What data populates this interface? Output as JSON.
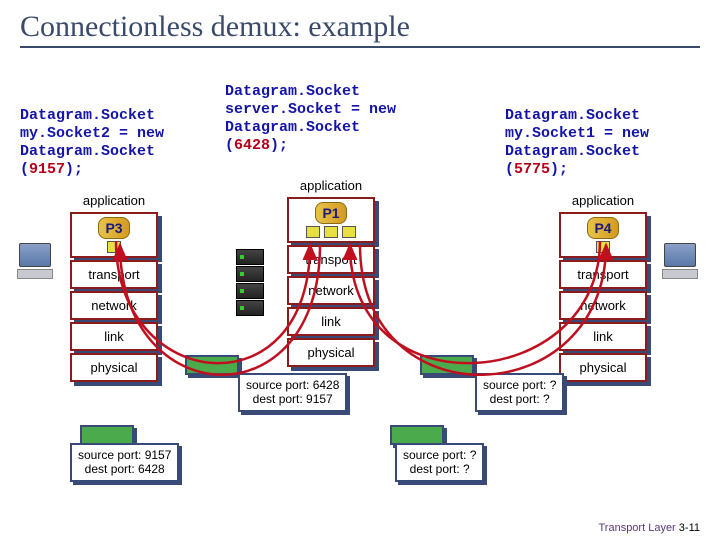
{
  "title": "Connectionless demux: example",
  "code_left": {
    "line1": "Datagram.Socket",
    "line2": " my.Socket2 = new",
    "line3": " Datagram.Socket",
    "line4a": " (",
    "line4b": "9157",
    "line4c": ");"
  },
  "code_center": {
    "line1": "Datagram.Socket",
    "line2": " server.Socket = new",
    "line3": " Datagram.Socket",
    "line4a": " (",
    "line4b": "6428",
    "line4c": ");"
  },
  "code_right": {
    "line1": "Datagram.Socket",
    "line2": " my.Socket1 = new",
    "line3": " Datagram.Socket",
    "line4a": " (",
    "line4b": "5775",
    "line4c": ");"
  },
  "stack_labels": {
    "application": "application",
    "transport": "transport",
    "network": "network",
    "link": "link",
    "physical": "physical"
  },
  "procs": {
    "left": "P3",
    "center": "P1",
    "right": "P4"
  },
  "pkt_left_out": {
    "l1": "source port: 9157",
    "l2": "dest port: 6428"
  },
  "pkt_left_in": {
    "l1": "source port: 6428",
    "l2": "dest port: 9157"
  },
  "pkt_right_out": {
    "l1": "source port: ?",
    "l2": "dest port: ?"
  },
  "pkt_right_in": {
    "l1": "source port: ?",
    "l2": "dest port: ?"
  },
  "footer": {
    "label": "Transport Layer",
    "page": "3-11"
  }
}
